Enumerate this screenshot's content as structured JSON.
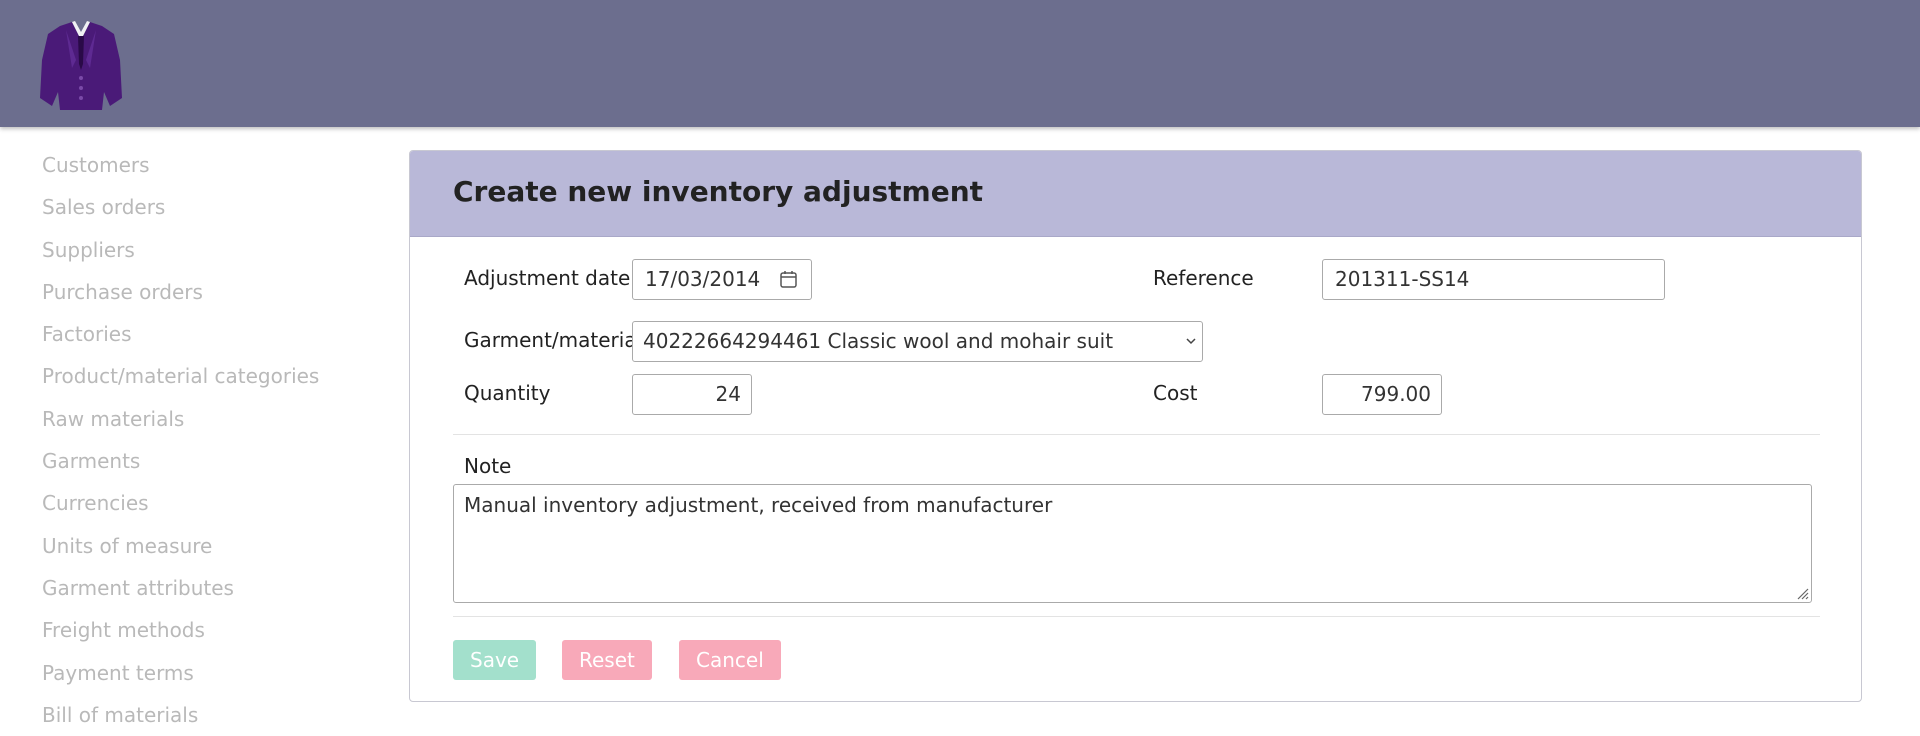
{
  "sidebar": {
    "items": [
      "Customers",
      "Sales orders",
      "Suppliers",
      "Purchase orders",
      "Factories",
      "Product/material categories",
      "Raw materials",
      "Garments",
      "Currencies",
      "Units of measure",
      "Garment attributes",
      "Freight methods",
      "Payment terms",
      "Bill of materials"
    ]
  },
  "form": {
    "title": "Create new inventory adjustment",
    "adjustment_date": {
      "label": "Adjustment date",
      "value": "17/03/2014"
    },
    "reference": {
      "label": "Reference",
      "value": "201311-SS14"
    },
    "garment": {
      "label": "Garment/material",
      "value": "40222664294461 Classic wool and mohair suit"
    },
    "quantity": {
      "label": "Quantity",
      "value": "24"
    },
    "cost": {
      "label": "Cost",
      "value": "799.00"
    },
    "note": {
      "label": "Note",
      "value": "Manual inventory adjustment, received from manufacturer"
    },
    "buttons": {
      "save": "Save",
      "reset": "Reset",
      "cancel": "Cancel"
    }
  },
  "colors": {
    "topbar": "#6c6e8e",
    "panel_header": "#b9b8d8",
    "save_button": "#a3e0cc",
    "danger_button": "#f8a9b9",
    "sidebar_text": "#b9b9b9"
  },
  "icons": [
    "suit-logo-icon",
    "calendar-icon",
    "chevron-down-icon",
    "resize-handle-icon"
  ]
}
